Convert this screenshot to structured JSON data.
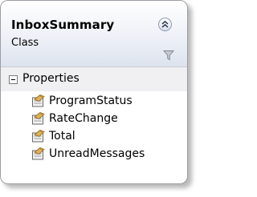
{
  "class_shape": {
    "name": "InboxSummary",
    "stereotype": "Class",
    "colors": {
      "border": "#9d9da1",
      "header_gradient_top": "#ffffff",
      "header_gradient_bottom": "#dde3ee",
      "compartment_bg": "#f0f0f3"
    }
  },
  "header_controls": {
    "collapse_icon": "double-chevron-up-icon",
    "filter_icon": "funnel-icon"
  },
  "compartments": [
    {
      "label": "Properties",
      "expander_icon": "minus-box-icon",
      "members": [
        {
          "label": "ProgramStatus",
          "icon": "property-icon"
        },
        {
          "label": "RateChange",
          "icon": "property-icon"
        },
        {
          "label": "Total",
          "icon": "property-icon"
        },
        {
          "label": "UnreadMessages",
          "icon": "property-icon"
        }
      ]
    }
  ]
}
